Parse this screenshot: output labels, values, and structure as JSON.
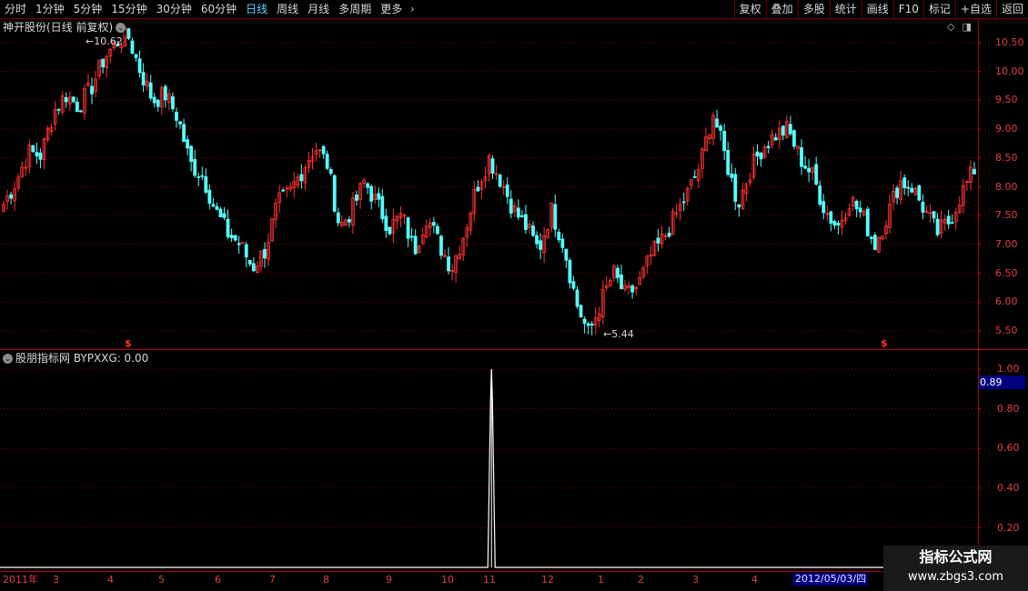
{
  "toolbar": {
    "periods": [
      "分时",
      "1分钟",
      "5分钟",
      "15分钟",
      "30分钟",
      "60分钟",
      "日线",
      "周线",
      "月线",
      "多周期",
      "更多"
    ],
    "active_period": "日线",
    "more_arrow": "chevron-right-icon",
    "actions": [
      "复权",
      "叠加",
      "多股",
      "统计",
      "画线",
      "F10",
      "标记",
      "+自选",
      "返回"
    ]
  },
  "main_chart": {
    "title": "神开股份(日线 前复权)",
    "dropdown_icon": "chevron-down-circle-icon",
    "corner_icons": [
      "diamond-icon",
      "panel-toggle-icon"
    ],
    "y_axis_labels": [
      "10.50",
      "10.00",
      "9.50",
      "9.00",
      "8.50",
      "8.00",
      "7.50",
      "7.00",
      "6.50",
      "6.00",
      "5.50"
    ],
    "high_annotation": "10.62",
    "low_annotation": "5.44",
    "signal_marks": [
      "$",
      "$"
    ]
  },
  "indicator_panel": {
    "title": "股朋指标网 BYPXXG: 0.00",
    "dropdown_icon": "chevron-down-circle-icon",
    "y_axis_labels": [
      "1.00",
      "0.80",
      "0.60",
      "0.40",
      "0.20"
    ],
    "current_value": "0.89"
  },
  "x_axis": {
    "labels": [
      "2011年",
      "3",
      "4",
      "5",
      "6",
      "7",
      "8",
      "9",
      "10",
      "11",
      "12",
      "1",
      "2",
      "3",
      "4"
    ],
    "cursor_date": "2012/05/03/四"
  },
  "watermark": {
    "title": "指标公式网",
    "url": "www.zbgs3.com"
  },
  "colors": {
    "up_candle": "#ff3232",
    "down_candle": "#54ffff",
    "axis_red": "#b00000",
    "grid_red": "#7a0000",
    "active_tab": "#5fd3ff"
  },
  "chart_data": {
    "type": "candlestick",
    "title": "神开股份(日线 前复权)",
    "ylim": [
      5.3,
      10.75
    ],
    "high": 10.62,
    "low": 5.44,
    "close_path": [
      7.7,
      8.1,
      8.6,
      8.55,
      9.3,
      9.6,
      9.4,
      9.7,
      10.2,
      10.5,
      10.62,
      10.0,
      9.5,
      9.6,
      9.2,
      8.4,
      8.2,
      7.6,
      7.2,
      7.0,
      6.6,
      6.9,
      7.7,
      7.9,
      8.3,
      8.7,
      8.4,
      7.3,
      7.6,
      8.1,
      7.7,
      7.3,
      7.5,
      6.9,
      7.5,
      7.0,
      6.6,
      7.2,
      8.0,
      8.5,
      8.1,
      7.6,
      7.3,
      6.9,
      7.6,
      7.0,
      6.0,
      5.44,
      6.0,
      6.5,
      6.1,
      6.3,
      6.8,
      7.1,
      7.5,
      7.9,
      8.4,
      9.3,
      8.5,
      7.7,
      8.3,
      8.7,
      8.9,
      9.0,
      8.5,
      8.2,
      7.6,
      7.3,
      7.8,
      7.5,
      7.0,
      7.5,
      8.1,
      8.0,
      7.6,
      7.2,
      7.4,
      7.9,
      8.3
    ],
    "indicator": {
      "name": "BYPXXG",
      "ylim": [
        0,
        1.05
      ],
      "spike_position": 0.47,
      "spike_value": 1.0,
      "current_value": 0.89
    }
  }
}
